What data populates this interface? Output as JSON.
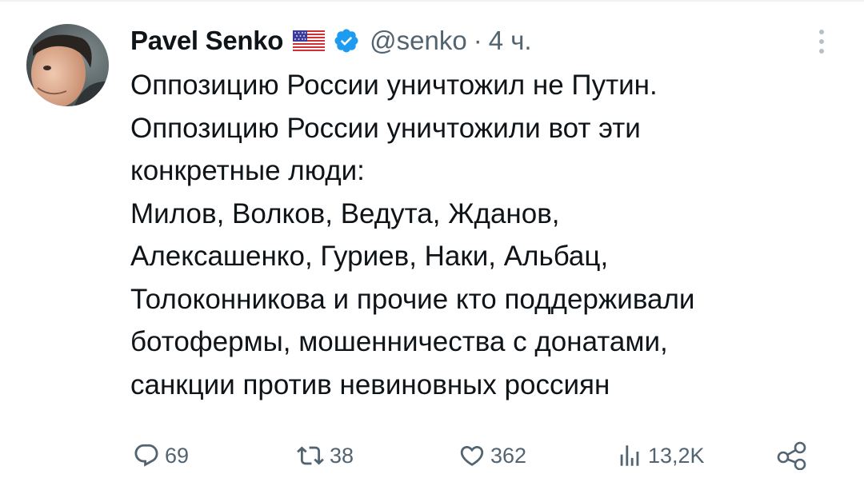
{
  "tweet": {
    "author": {
      "name": "Pavel Senko",
      "handle": "@senko",
      "flag_icon": "us-flag-icon",
      "verified_icon": "verified-badge-icon",
      "avatar": "avatar"
    },
    "separator": "·",
    "time": "4 ч.",
    "text": "Оппозицию России уничтожил не Путин.\nОппозицию России уничтожили вот эти\nконкретные люди:\nМилов, Волков, Ведута, Жданов,\nАлексашенко, Гуриев, Наки, Альбац,\nТолоконникова и прочие кто поддерживали\nботофермы, мошенничества с донатами,\nсанкции против невиновных россиян",
    "actions": {
      "replies": "69",
      "retweets": "38",
      "likes": "362",
      "views": "13,2K"
    }
  },
  "icons": {
    "more": "more-options-icon",
    "reply": "reply-icon",
    "retweet": "retweet-icon",
    "like": "heart-icon",
    "views": "views-icon",
    "share": "share-icon"
  },
  "colors": {
    "text": "#0f1419",
    "secondary": "#536471",
    "verified": "#1d9bf0",
    "divider": "#eff3f4"
  }
}
